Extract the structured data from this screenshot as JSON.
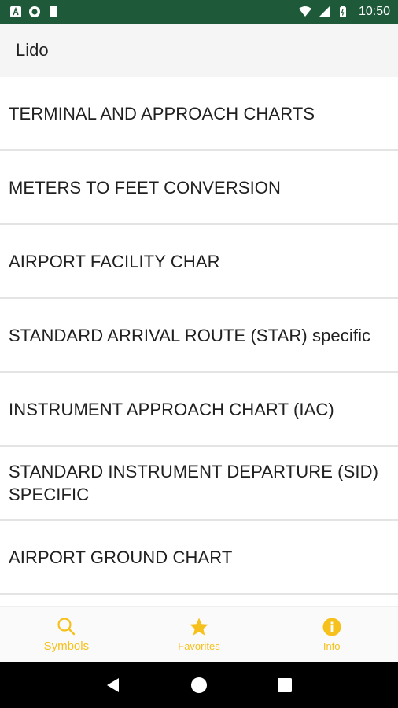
{
  "status_bar": {
    "time": "10:50",
    "icons_left": [
      "notification-a-icon",
      "record-icon",
      "sd-card-icon"
    ],
    "icons_right": [
      "wifi-icon",
      "signal-icon",
      "battery-icon"
    ],
    "color": "#1e5a3a"
  },
  "app_bar": {
    "title": "Lido"
  },
  "list": {
    "items": [
      {
        "label": "TERMINAL AND APPROACH CHARTS"
      },
      {
        "label": "METERS TO FEET CONVERSION"
      },
      {
        "label": "AIRPORT FACILITY CHAR"
      },
      {
        "label": "STANDARD ARRIVAL ROUTE (STAR) specific"
      },
      {
        "label": "INSTRUMENT APPROACH CHART (IAC)"
      },
      {
        "label": "STANDARD INSTRUMENT DEPARTURE (SID) SPECIFIC"
      },
      {
        "label": "AIRPORT GROUND CHART"
      }
    ]
  },
  "bottom_nav": {
    "accent_color": "#f6c11c",
    "items": [
      {
        "label": "Symbols",
        "icon": "search-icon"
      },
      {
        "label": "Favorites",
        "icon": "star-icon"
      },
      {
        "label": "Info",
        "icon": "info-icon"
      }
    ]
  },
  "system_nav": {
    "buttons": [
      "back-icon",
      "home-icon",
      "recents-icon"
    ]
  }
}
